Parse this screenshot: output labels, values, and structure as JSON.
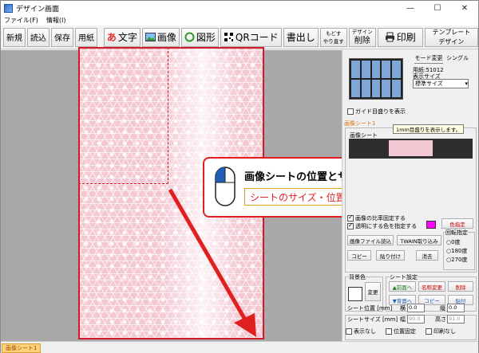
{
  "window": {
    "title": "デザイン画面",
    "minimize": "—",
    "maximize": "☐",
    "close": "✕"
  },
  "menu": [
    "ファイル(F)",
    "情報(I)"
  ],
  "toolbar": {
    "new": "新規",
    "open": "読込",
    "save": "保存",
    "paper": "用紙",
    "text": "文字",
    "text_glyph": "あ",
    "image": "画像",
    "shape": "図形",
    "qr": "QRコード",
    "write": "書出し",
    "undo_line1": "もどす",
    "undo_line2": "やり直す",
    "del_line1": "デザイン",
    "del_line2": "削除",
    "print": "印刷",
    "template_line1": "テンプレート",
    "template_line2": "デザイン"
  },
  "callout": {
    "title": "画像シートの位置とサイズを変更",
    "link": "シートのサイズ・位置の変更方法はこちら"
  },
  "panel": {
    "mode_change": "モード変更",
    "single": "シングル",
    "paper_label": "用紙:",
    "paper_value": "51012",
    "display_size_label": "表示サイズ",
    "display_size_value": "標準サイズ",
    "guide_check": "ガイド目盛りを表示",
    "sheet_tab": "画像シート1",
    "image_sheet_label": "画像シート",
    "tooltip": "1mm目盛りを表示します。",
    "option1": "画像の比率固定する",
    "option2": "透明にする色を指定する",
    "specify_color": "色指定",
    "file_read": "画像ファイル読込",
    "twain": "TWAIN取り込み",
    "copy": "コピー",
    "paste": "貼り付け",
    "erase": "消去",
    "rotate_label": "回転指定",
    "rot0": "0度",
    "rot180": "180度",
    "rot270": "270度",
    "bg_label": "背景色",
    "change": "変更",
    "sheet_settings": "シート設定",
    "front": "▲前面へ",
    "rename": "名称変更",
    "delete": "削除",
    "back": "▼背面へ",
    "sheet_copy": "コピー",
    "sheet_paste": "貼付",
    "pos_label": "シート位置 [mm]",
    "x_label": "横",
    "x_value": "0.0",
    "y_label": "縦",
    "y_value": "0.0",
    "size_label": "シートサイズ [mm]",
    "w_label": "幅",
    "w_value": "90.0",
    "h_label": "高さ",
    "h_value": "91.0",
    "hide": "表示なし",
    "lock": "位置固定",
    "noprint": "印刷なし"
  },
  "status": {
    "tab": "画像シート1"
  }
}
